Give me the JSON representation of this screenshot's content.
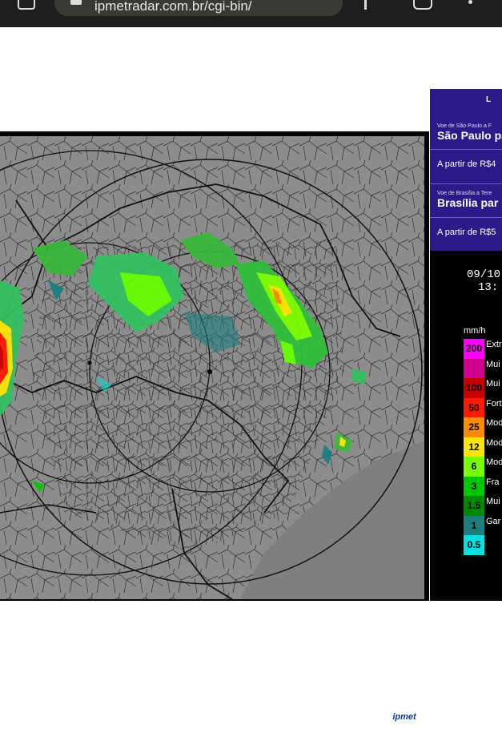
{
  "browser": {
    "url": "ipmetradar.com.br/cgi-bin/"
  },
  "ad": {
    "brand": "L",
    "offers": [
      {
        "small": "Voe de São Paulo a F",
        "big": "São Paulo par",
        "price": "A partir de R$4"
      },
      {
        "small": "Voe de Brasília a Tere",
        "big": "Brasília par",
        "price": "A partir de R$5"
      }
    ]
  },
  "radar": {
    "date": "09/10",
    "time": "13:",
    "unit": "mm/h",
    "watermark": "ipmet",
    "scale": [
      {
        "value": "200",
        "label": "Extr",
        "color": "#ff00ff"
      },
      {
        "value": "",
        "label": "Mui",
        "color": "#d1008f"
      },
      {
        "value": "100",
        "label": "Mui",
        "color": "#c80000"
      },
      {
        "value": "50",
        "label": "Fort",
        "color": "#ff1a00"
      },
      {
        "value": "25",
        "label": "Mod",
        "color": "#ff8c00"
      },
      {
        "value": "12",
        "label": "Mod",
        "color": "#ffe600"
      },
      {
        "value": "6",
        "label": "Mod",
        "color": "#78ff00"
      },
      {
        "value": "3",
        "label": "Fra",
        "color": "#00c800"
      },
      {
        "value": "1.5",
        "label": "Mui",
        "color": "#008a00"
      },
      {
        "value": "1",
        "label": "Gar",
        "color": "#1b7f7f"
      },
      {
        "value": "0.5",
        "label": "",
        "color": "#00e0e0"
      }
    ]
  }
}
